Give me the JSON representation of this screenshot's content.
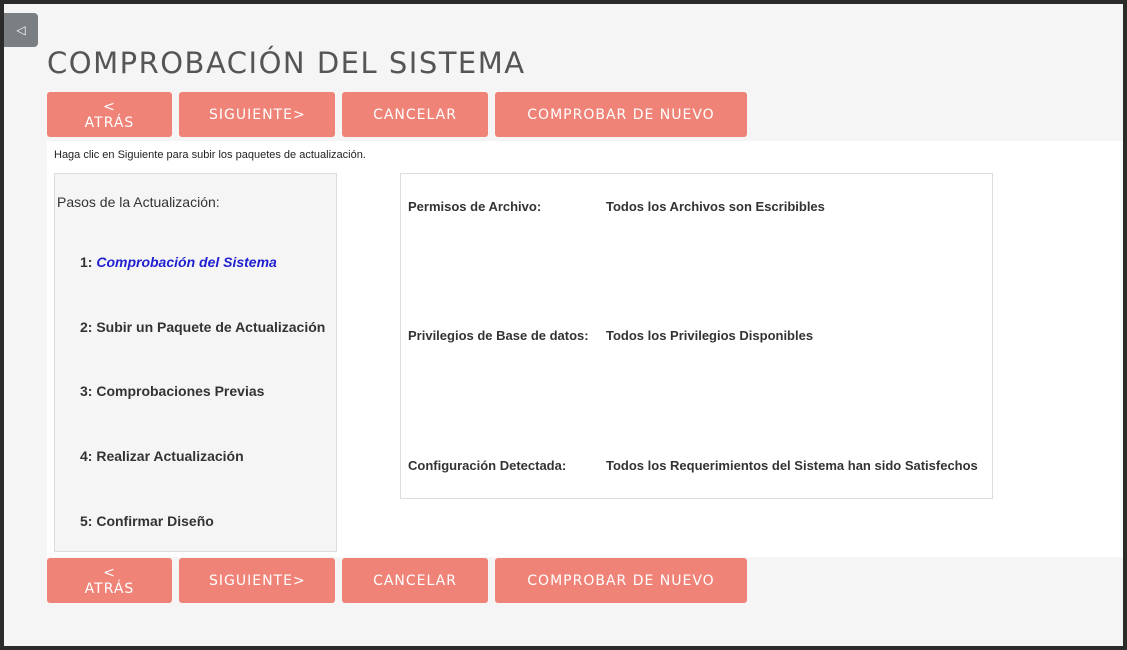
{
  "page": {
    "title": "COMPROBACIÓN DEL SISTEMA",
    "collapse_icon": "◁",
    "accent_color": "#f08377"
  },
  "toolbar": {
    "back_label": "< ATRÁS",
    "next_label": "SIGUIENTE>",
    "cancel_label": "CANCELAR",
    "recheck_label": "COMPROBAR DE NUEVO"
  },
  "hint": "Haga clic en Siguiente para subir los paquetes de actualización.",
  "steps": {
    "title": "Pasos de la Actualización:",
    "items": [
      {
        "number": "1: ",
        "label": "Comprobación del Sistema",
        "current": true
      },
      {
        "number": "2: ",
        "label": "Subir un Paquete de Actualización"
      },
      {
        "number": "3: ",
        "label": "Comprobaciones Previas"
      },
      {
        "number": "4: ",
        "label": "Realizar Actualización"
      },
      {
        "number": "5: ",
        "label": "Confirmar Diseño"
      }
    ]
  },
  "checks": [
    {
      "label": "Permisos de Archivo:",
      "value": "Todos los Archivos son Escribibles"
    },
    {
      "label": "Privilegios de Base de datos:",
      "value": "Todos los Privilegios Disponibles"
    },
    {
      "label": "Configuración Detectada:",
      "value": "Todos los Requerimientos del Sistema han sido Satisfechos"
    }
  ]
}
